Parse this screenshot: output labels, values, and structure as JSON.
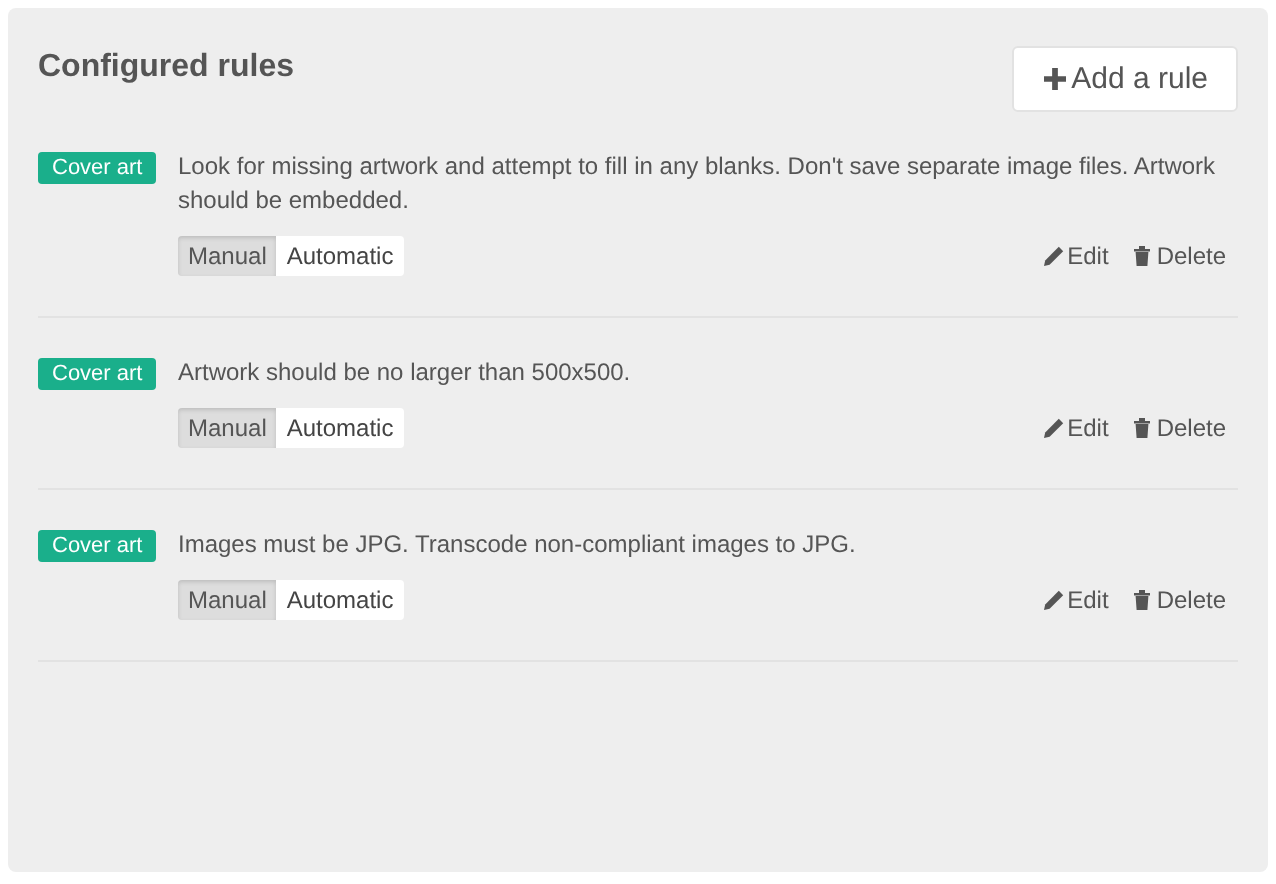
{
  "panel": {
    "title": "Configured rules",
    "add_button": "Add a rule"
  },
  "rules": [
    {
      "tag": "Cover art",
      "color": "#1aaf8b",
      "description": "Look for missing artwork and attempt to fill in any blanks. Don't save separate image files. Artwork should be embedded.",
      "modes": [
        {
          "label": "Manual",
          "selected": true
        },
        {
          "label": "Automatic",
          "selected": false
        }
      ],
      "edit": "Edit",
      "delete": "Delete"
    },
    {
      "tag": "Cover art",
      "color": "#1aaf8b",
      "description": "Artwork should be no larger than 500x500.",
      "modes": [
        {
          "label": "Manual",
          "selected": true
        },
        {
          "label": "Automatic",
          "selected": false
        }
      ],
      "edit": "Edit",
      "delete": "Delete"
    },
    {
      "tag": "Cover art",
      "color": "#1aaf8b",
      "description": "Images must be JPG. Transcode non-compliant images to JPG.",
      "modes": [
        {
          "label": "Manual",
          "selected": true
        },
        {
          "label": "Automatic",
          "selected": false
        }
      ],
      "edit": "Edit",
      "delete": "Delete"
    }
  ]
}
